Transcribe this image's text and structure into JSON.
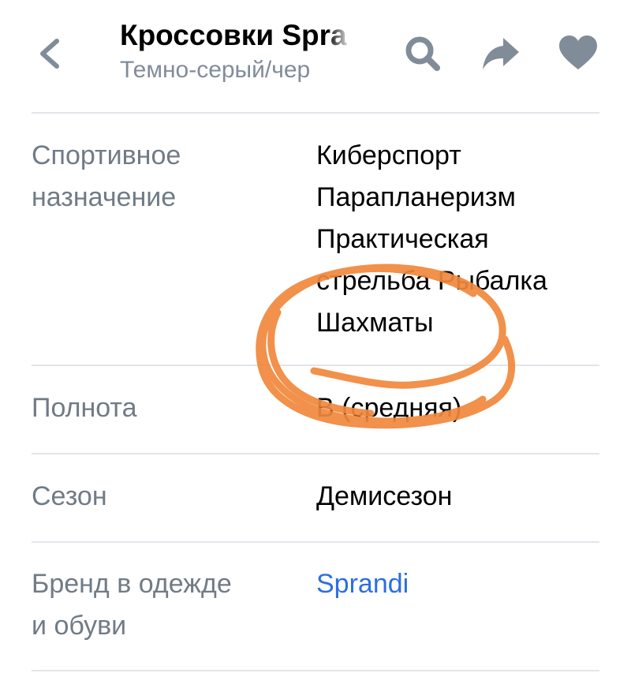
{
  "header": {
    "title": "Кроссовки Spra",
    "subtitle": "Темно-серый/чер",
    "icons": {
      "back": "chevron-left-icon",
      "search": "search-icon",
      "share": "share-arrow-icon",
      "like": "heart-icon"
    }
  },
  "attributes": [
    {
      "label_lines": [
        "Спортивное",
        "назначение"
      ],
      "values": [
        "Киберспорт",
        "Парапланеризм",
        "Практическая",
        "стрельба Рыбалка",
        "Шахматы"
      ]
    },
    {
      "label_lines": [
        "Полнота"
      ],
      "values": [
        "В (средняя)"
      ]
    },
    {
      "label_lines": [
        "Сезон"
      ],
      "values": [
        "Демисезон"
      ]
    },
    {
      "label_lines": [
        "Бренд в одежде",
        "и обуви"
      ],
      "values": [
        "Sprandi"
      ],
      "is_link": true
    }
  ],
  "colors": {
    "label": "#707b86",
    "value": "#000000",
    "link": "#2c6fe0",
    "icon": "#818c99",
    "divider": "#e2e5ea",
    "annotation": "#f0883c"
  }
}
